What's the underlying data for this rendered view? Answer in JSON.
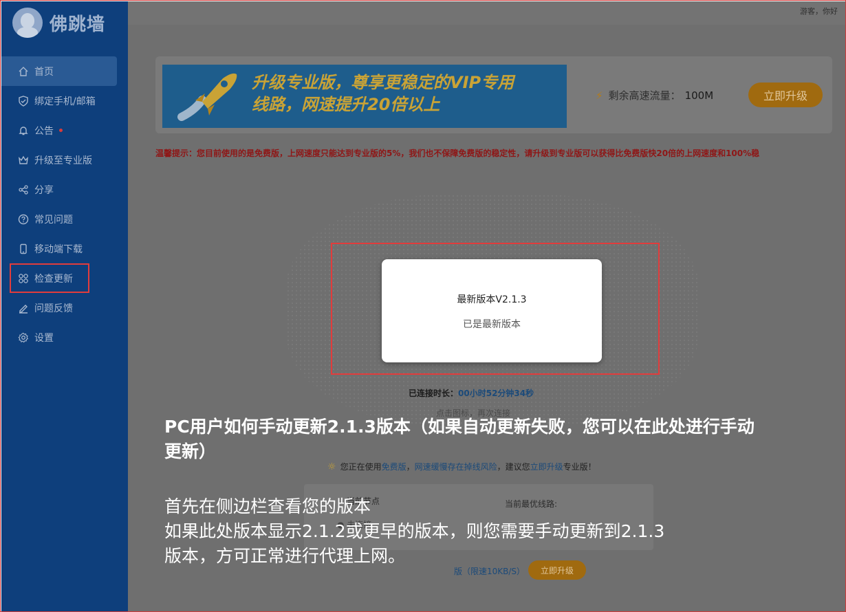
{
  "brand": {
    "name": "佛跳墙",
    "logo_icon": "monk-avatar-icon"
  },
  "sidebar": {
    "items": [
      {
        "label": "首页",
        "icon": "home-icon",
        "active": true
      },
      {
        "label": "绑定手机/邮箱",
        "icon": "shield-icon"
      },
      {
        "label": "公告",
        "icon": "bell-icon",
        "badge_dot": true
      },
      {
        "label": "升级至专业版",
        "icon": "crown-icon"
      },
      {
        "label": "分享",
        "icon": "share-icon"
      },
      {
        "label": "常见问题",
        "icon": "question-icon"
      },
      {
        "label": "移动端下载",
        "icon": "phone-icon"
      },
      {
        "label": "检查更新",
        "icon": "grid-icon",
        "highlighted": true
      },
      {
        "label": "问题反馈",
        "icon": "pen-icon"
      },
      {
        "label": "设置",
        "icon": "gear-icon"
      }
    ]
  },
  "header": {
    "greeting": "游客，你好"
  },
  "banner": {
    "line1": "升级专业版，尊享更稳定的VIP专用",
    "line2": "线路，网速提升20倍以上",
    "traffic_label": "剩余高速流量：",
    "traffic_value": "100M",
    "upgrade_label": "立即升级"
  },
  "tip": "温馨提示：您目前使用的是免费版，上网速度只能达到专业版的5%，我们也不保障免费版的稳定性，请升级到专业版可以获得比免费版快20倍的上网速度和100%稳",
  "dialog": {
    "title": "最新版本V2.1.3",
    "message": "已是最新版本"
  },
  "connection": {
    "duration_label": "已连接时长：",
    "duration_value": "00小时52分钟34秒",
    "reconnect_hint": "点击图标，再次连接"
  },
  "notice": {
    "prefix": "您正在使用",
    "free": "免费版",
    "sep": "，",
    "risk": "网速缓慢存在掉线风险",
    "middle": "，建议您",
    "upgrade": "立即升级",
    "suffix": "专业版！"
  },
  "info": {
    "col1_label": "当前节点",
    "col2_label": "当前最优线路:",
    "status": "● 未连接"
  },
  "footer": {
    "speed": "版（限速10KB/S）",
    "upgrade_label": "立即升级"
  },
  "caption": {
    "title": "PC用户如何手动更新2.1.3版本（如果自动更新失败，您可以在此处进行手动更新）",
    "lines": [
      "首先在侧边栏查看您的版本",
      "如果此处版本显示2.1.2或更早的版本，则您需要手动更新到2.1.3",
      "版本，方可正常进行代理上网。"
    ]
  },
  "colors": {
    "sidebar_bg": "#0e3f7c",
    "highlight_red": "#e23c3c",
    "upgrade_orange": "#a06a0f",
    "tip_red": "#8f1616"
  }
}
